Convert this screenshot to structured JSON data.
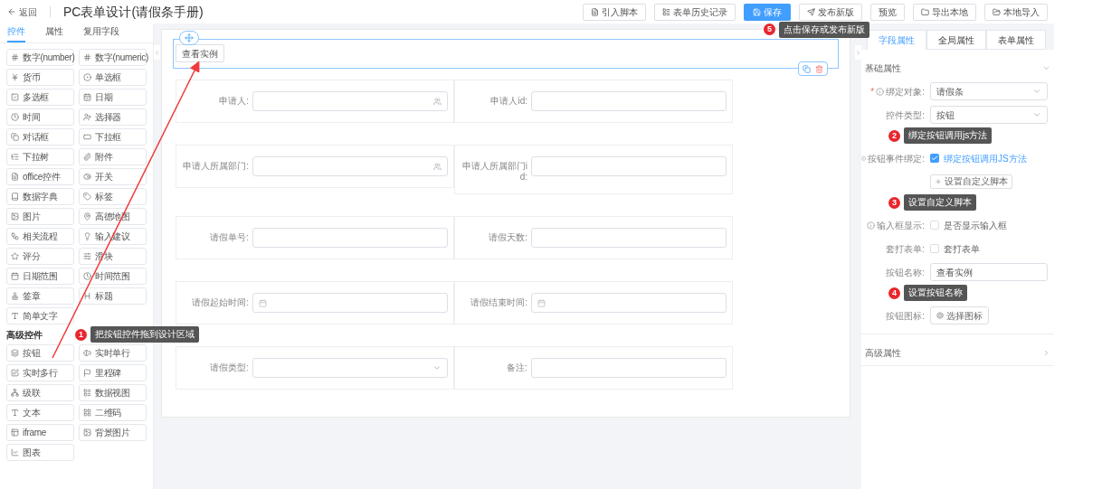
{
  "header": {
    "back": "返回",
    "title": "PC表单设计(请假条手册)",
    "actions": [
      {
        "label": "引入脚本",
        "kind": "default"
      },
      {
        "label": "表单历史记录",
        "kind": "default"
      },
      {
        "label": "保存",
        "kind": "primary",
        "callout": {
          "number": "5",
          "text": "点击保存或发布新版"
        }
      },
      {
        "label": "发布新版",
        "kind": "default"
      },
      {
        "label": "预览",
        "kind": "default"
      },
      {
        "label": "导出本地",
        "kind": "default"
      },
      {
        "label": "本地导入",
        "kind": "default"
      }
    ]
  },
  "sidebar": {
    "tabs": [
      {
        "label": "控件",
        "selected": true
      },
      {
        "label": "属性",
        "selected": false
      },
      {
        "label": "复用字段",
        "selected": false
      }
    ],
    "groups": [
      {
        "items": [
          "数字(number)",
          "数字(numeric)",
          "货币",
          "单选框",
          "多选框",
          "日期",
          "时间",
          "选择器",
          "对话框",
          "下拉框",
          "下拉树",
          "附件",
          "office控件",
          "开关",
          "数据字典",
          "标签",
          "图片",
          "高德地图",
          "相关流程",
          "输入建议",
          "评分",
          "滑块",
          "日期范围",
          "时间范围",
          "签章",
          "标题",
          "简单文字"
        ]
      },
      {
        "title": "高级控件",
        "callout": {
          "number": "1",
          "text": "把按钮控件拖到设计区域"
        },
        "items": [
          "按钮",
          "实时单行",
          "实时多行",
          "里程碑",
          "级联",
          "数据视图",
          "文本",
          "二维码",
          "iframe",
          "背景图片",
          "图表"
        ]
      }
    ]
  },
  "canvas": {
    "button_block": {
      "label": "查看实例",
      "selected": true
    },
    "rows": [
      [
        {
          "label": "申请人:",
          "kind": "user"
        },
        {
          "label": "申请人id:",
          "kind": "text"
        }
      ],
      [
        {
          "label": "申请人所属部门:",
          "kind": "user"
        },
        {
          "label": "申请人所属部门id:",
          "kind": "text"
        }
      ],
      [
        {
          "label": "请假单号:",
          "kind": "text"
        },
        {
          "label": "请假天数:",
          "kind": "text"
        }
      ],
      [
        {
          "label": "请假起始时间:",
          "kind": "date"
        },
        {
          "label": "请假结束时间:",
          "kind": "date"
        }
      ],
      [
        {
          "label": "请假类型:",
          "kind": "select"
        },
        {
          "label": "备注:",
          "kind": "text"
        }
      ]
    ]
  },
  "properties": {
    "tabs": [
      {
        "label": "字段属性",
        "selected": true
      },
      {
        "label": "全局属性",
        "selected": false
      },
      {
        "label": "表单属性",
        "selected": false
      }
    ],
    "sections": [
      {
        "title": "基础属性",
        "expanded": true,
        "rows": [
          {
            "kind": "select",
            "label": "绑定对象:",
            "required_mark": "*",
            "help": true,
            "value": "请假条"
          },
          {
            "kind": "select",
            "label": "控件类型:",
            "value": "按钮",
            "callout": {
              "number": "2",
              "text": "绑定按钮调用js方法"
            }
          },
          {
            "kind": "checkbox",
            "label": "按钮事件绑定:",
            "help": true,
            "text": "绑定按钮调用JS方法",
            "checked": true
          },
          {
            "kind": "button",
            "text": "设置自定义脚本",
            "callout": {
              "number": "3",
              "text": "设置自定义脚本"
            }
          },
          {
            "kind": "checkbox",
            "label": "输入框显示:",
            "help": true,
            "text": "是否显示输入框",
            "checked": false
          },
          {
            "kind": "checkbox",
            "label": "套打表单:",
            "text": "套打表单",
            "checked": false
          },
          {
            "kind": "input",
            "label": "按钮名称:",
            "value": "查看实例",
            "callout": {
              "number": "4",
              "text": "设置按钮名称"
            }
          },
          {
            "kind": "icon-picker",
            "label": "按钮图标:",
            "text": "选择图标"
          }
        ]
      },
      {
        "title": "高级属性",
        "expanded": false
      }
    ]
  }
}
